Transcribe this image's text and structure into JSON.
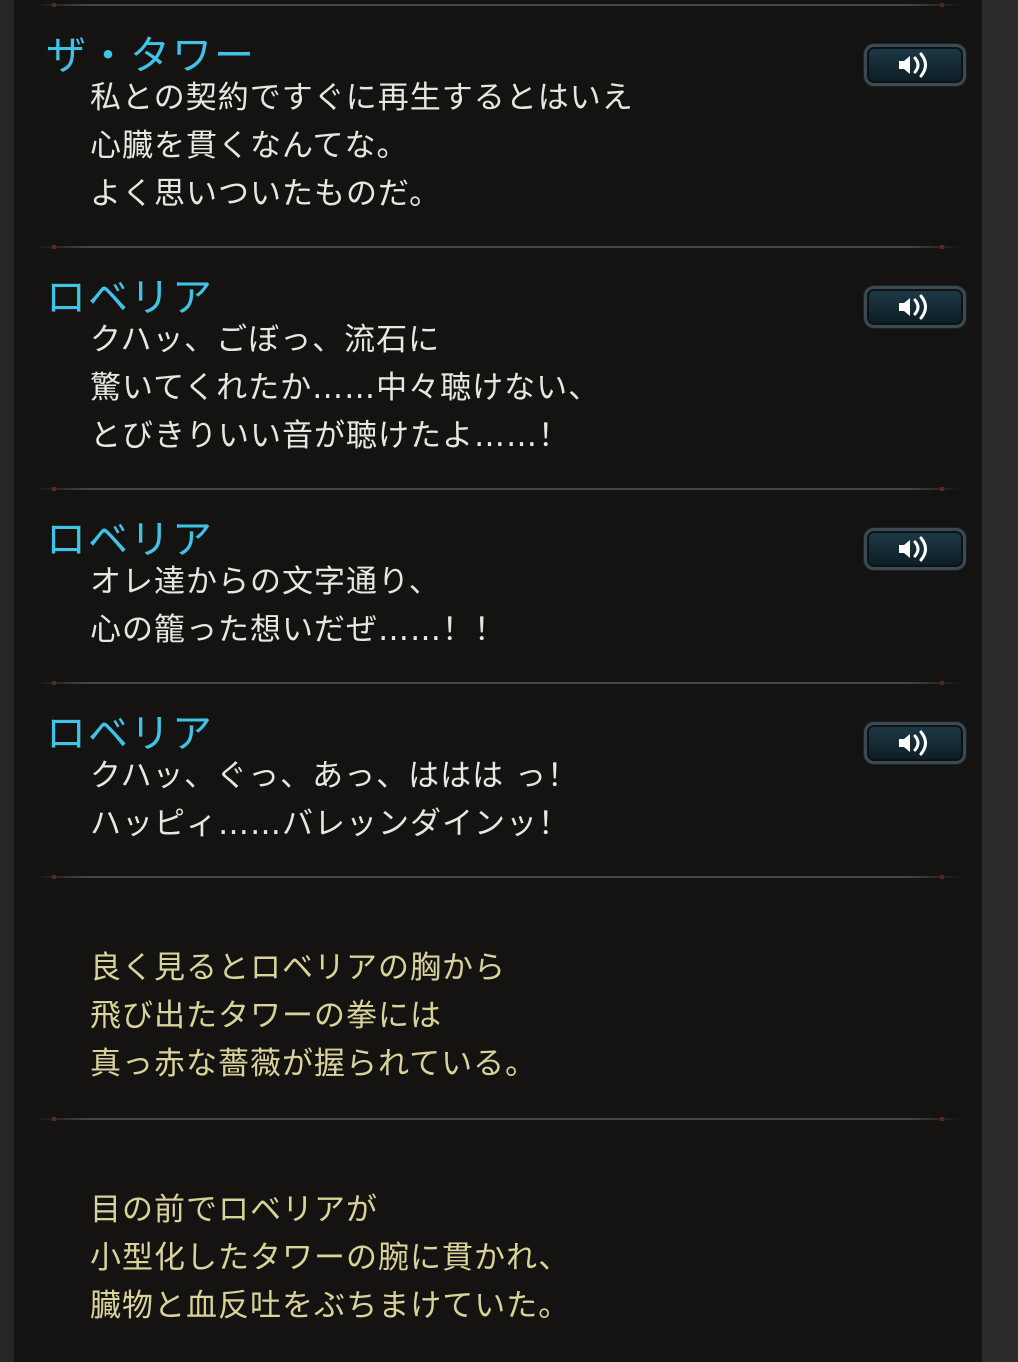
{
  "entries": [
    {
      "speaker": "ザ・タワー",
      "has_voice": true,
      "lines": [
        "私との契約ですぐに再生するとはいえ",
        "心臓を貫くなんてな。",
        "よく思いついたものだ。"
      ]
    },
    {
      "speaker": "ロベリア",
      "has_voice": true,
      "lines": [
        "クハッ、ごぼっ、流石に",
        "驚いてくれたか……中々聴けない、",
        "とびきりいい音が聴けたよ……！"
      ]
    },
    {
      "speaker": "ロベリア",
      "has_voice": true,
      "lines": [
        "オレ達からの文字通り、",
        "心の籠った想いだぜ……！！"
      ]
    },
    {
      "speaker": "ロベリア",
      "has_voice": true,
      "lines": [
        "クハッ、ぐっ、あっ、ははは っ！",
        "ハッピィ……バレッンダインッ！"
      ]
    },
    {
      "speaker": "",
      "has_voice": false,
      "lines": [
        "良く見るとロベリアの胸から",
        "飛び出たタワーの拳には",
        "真っ赤な薔薇が握られている。"
      ]
    },
    {
      "speaker": "",
      "has_voice": false,
      "lines": [
        "目の前でロベリアが",
        "小型化したタワーの腕に貫かれ、",
        "臓物と血反吐をぶちまけていた。"
      ]
    }
  ],
  "icons": {
    "voice": "speaker-volume-icon"
  },
  "colors": {
    "speaker_name": "#3fc3e6",
    "dialogue_text": "#e8e6e1",
    "narration_text": "#d8d39a",
    "background": "#151312"
  }
}
